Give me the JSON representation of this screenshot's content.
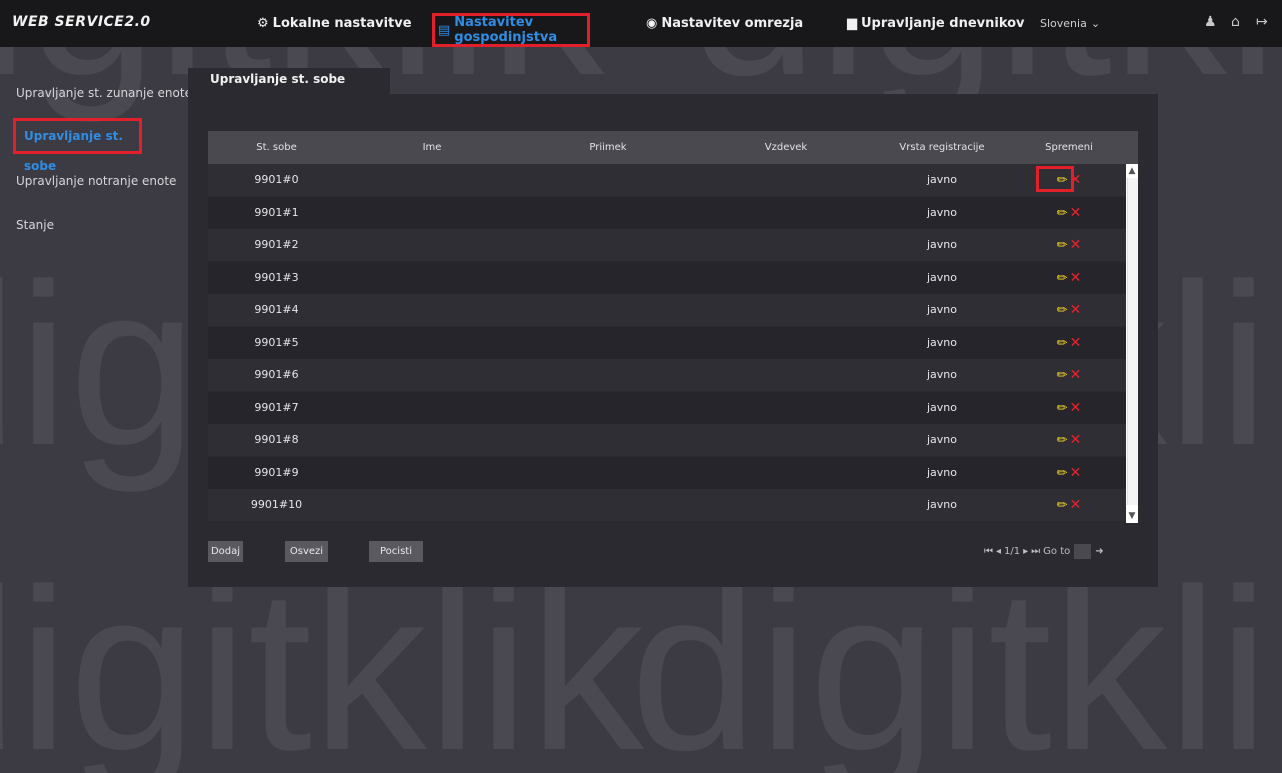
{
  "app": {
    "logo": "WEB SERVICE2.0"
  },
  "nav": {
    "items": [
      {
        "icon": "⚙",
        "label": "Lokalne nastavitve"
      },
      {
        "icon": "▤",
        "label": "Nastavitev gospodinjstva"
      },
      {
        "icon": "◉",
        "label": "Nastavitev omrezja"
      },
      {
        "icon": "▆",
        "label": "Upravljanje dnevnikov"
      }
    ],
    "language": "Slovenia",
    "language_arrow": "⌄",
    "right_icons": [
      "user-icon",
      "home-icon",
      "logout-icon"
    ]
  },
  "sidebar": {
    "items": [
      {
        "label": "Upravljanje st. zunanje enote"
      },
      {
        "label": "Upravljanje st. sobe"
      },
      {
        "label": "Upravljanje notranje enote"
      },
      {
        "label": "Stanje"
      }
    ]
  },
  "tab": {
    "label": "Upravljanje st. sobe"
  },
  "table": {
    "headers": [
      "St. sobe",
      "Ime",
      "Priimek",
      "Vzdevek",
      "Vrsta registracije",
      "Spremeni"
    ],
    "rows": [
      {
        "room": "9901#0",
        "ime": "",
        "priimek": "",
        "vzdevek": "",
        "type": "javno"
      },
      {
        "room": "9901#1",
        "ime": "",
        "priimek": "",
        "vzdevek": "",
        "type": "javno"
      },
      {
        "room": "9901#2",
        "ime": "",
        "priimek": "",
        "vzdevek": "",
        "type": "javno"
      },
      {
        "room": "9901#3",
        "ime": "",
        "priimek": "",
        "vzdevek": "",
        "type": "javno"
      },
      {
        "room": "9901#4",
        "ime": "",
        "priimek": "",
        "vzdevek": "",
        "type": "javno"
      },
      {
        "room": "9901#5",
        "ime": "",
        "priimek": "",
        "vzdevek": "",
        "type": "javno"
      },
      {
        "room": "9901#6",
        "ime": "",
        "priimek": "",
        "vzdevek": "",
        "type": "javno"
      },
      {
        "room": "9901#7",
        "ime": "",
        "priimek": "",
        "vzdevek": "",
        "type": "javno"
      },
      {
        "room": "9901#8",
        "ime": "",
        "priimek": "",
        "vzdevek": "",
        "type": "javno"
      },
      {
        "room": "9901#9",
        "ime": "",
        "priimek": "",
        "vzdevek": "",
        "type": "javno"
      },
      {
        "room": "9901#10",
        "ime": "",
        "priimek": "",
        "vzdevek": "",
        "type": "javno"
      }
    ],
    "edit_glyph": "✏",
    "delete_glyph": "✕"
  },
  "buttons": {
    "add": "Dodaj",
    "refresh": "Osvezi",
    "clear": "Pocisti"
  },
  "pager": {
    "first": "⏮",
    "prev": "◂",
    "page": "1/1",
    "next": "▸",
    "last": "⏭",
    "goto_label": "Go to",
    "go": "➜"
  },
  "watermark": {
    "text": "digitklik"
  },
  "colors": {
    "accent": "#2f8de4",
    "highlight": "#e2202c",
    "edit": "#f5d423",
    "delete": "#e8222d"
  }
}
